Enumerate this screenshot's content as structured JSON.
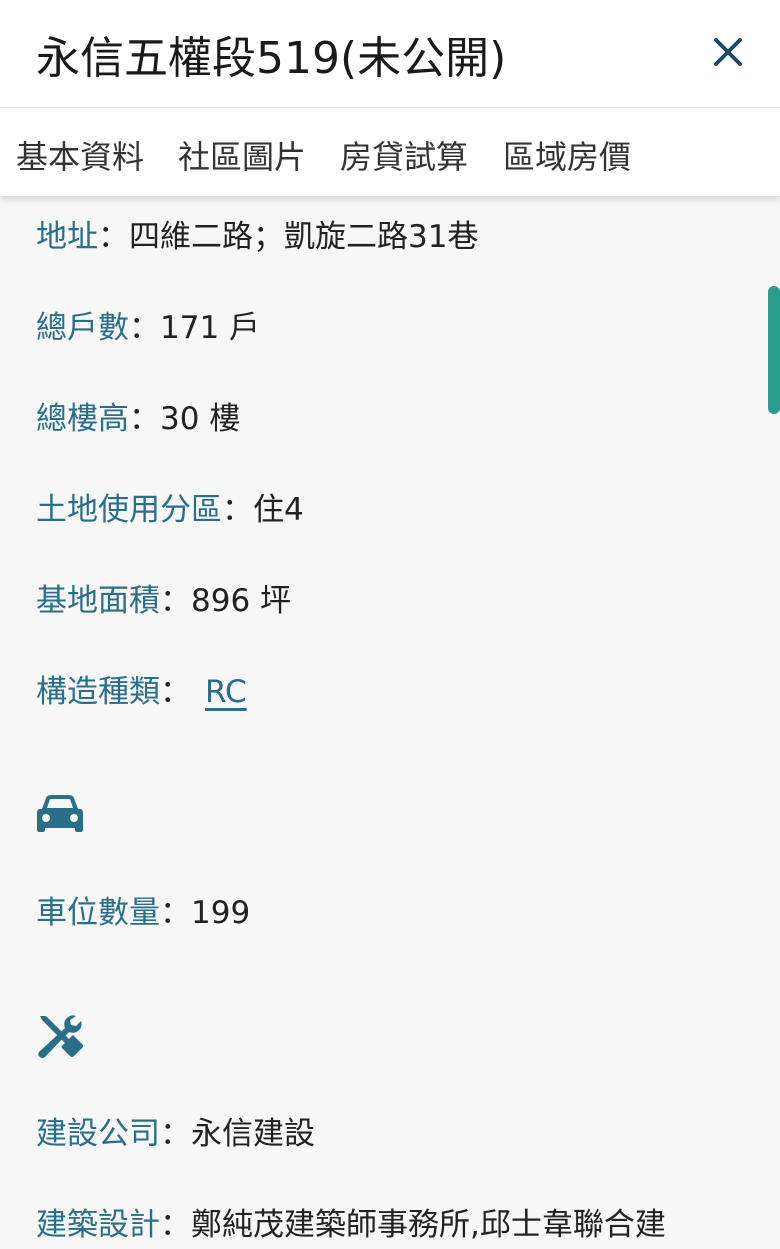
{
  "header": {
    "title": "永信五權段519(未公開)",
    "close_icon": "close-icon"
  },
  "tabs": [
    {
      "label": "基本資料"
    },
    {
      "label": "社區圖片"
    },
    {
      "label": "房貸試算"
    },
    {
      "label": "區域房價"
    }
  ],
  "info": {
    "address": {
      "label": "地址",
      "value": "四維二路；凱旋二路31巷"
    },
    "households": {
      "label": "總戶數",
      "value": "171 戶"
    },
    "floors": {
      "label": "總樓高",
      "value": "30 樓"
    },
    "zoning": {
      "label": "土地使用分區",
      "value": "住4"
    },
    "land_area": {
      "label": "基地面積",
      "value": "896 坪"
    },
    "structure": {
      "label": "構造種類",
      "value": "RC"
    }
  },
  "parking": {
    "icon": "car-icon",
    "count": {
      "label": "車位數量",
      "value": "199"
    }
  },
  "builder": {
    "icon": "tools-icon",
    "company": {
      "label": "建設公司",
      "value": "永信建設"
    },
    "architect": {
      "label": "建築設計",
      "value": "鄭純茂建築師事務所,邱士韋聯合建"
    }
  },
  "colors": {
    "accent": "#2a6f8a",
    "scrollbar": "#2a9d8f",
    "background": "#f7f7f7"
  }
}
